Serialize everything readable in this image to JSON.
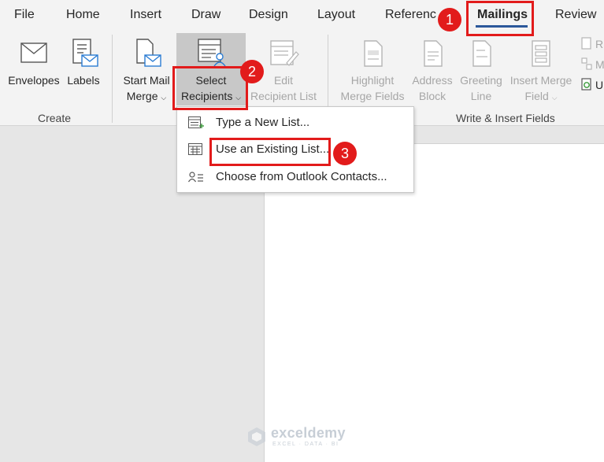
{
  "tabs": [
    {
      "label": "File"
    },
    {
      "label": "Home"
    },
    {
      "label": "Insert"
    },
    {
      "label": "Draw"
    },
    {
      "label": "Design"
    },
    {
      "label": "Layout"
    },
    {
      "label": "Referenc"
    },
    {
      "label": "Mailings"
    },
    {
      "label": "Review"
    }
  ],
  "ribbon": {
    "create_group": {
      "label": "Create",
      "envelopes": "Envelopes",
      "labels": "Labels"
    },
    "start_merge": {
      "line1": "Start Mail",
      "line2": "Merge"
    },
    "select_recipients": {
      "line1": "Select",
      "line2": "Recipients"
    },
    "edit_recipient_list": {
      "line1": "Edit",
      "line2": "Recipient List"
    },
    "write_insert_group": {
      "label": "Write & Insert Fields",
      "highlight": {
        "line1": "Highlight",
        "line2": "Merge Fields"
      },
      "address_block": {
        "line1": "Address",
        "line2": "Block"
      },
      "greeting_line": {
        "line1": "Greeting",
        "line2": "Line"
      },
      "insert_merge": {
        "line1": "Insert Merge",
        "line2": "Field"
      }
    },
    "right_edge": {
      "item1": "R",
      "item2": "M",
      "item3": "U"
    }
  },
  "dropdown_menu": {
    "items": [
      {
        "label": "Type a New List..."
      },
      {
        "label": "Use an Existing List..."
      },
      {
        "label": "Choose from Outlook Contacts..."
      }
    ]
  },
  "annotations": {
    "badge1": "1",
    "badge2": "2",
    "badge3": "3"
  },
  "watermark": {
    "name": "exceldemy",
    "tagline": "EXCEL · DATA · BI"
  },
  "colors": {
    "accent_blue": "#2b579a",
    "highlight_red": "#e21b1b",
    "ribbon_bg": "#f3f3f3",
    "canvas_bg": "#e6e6e6"
  }
}
